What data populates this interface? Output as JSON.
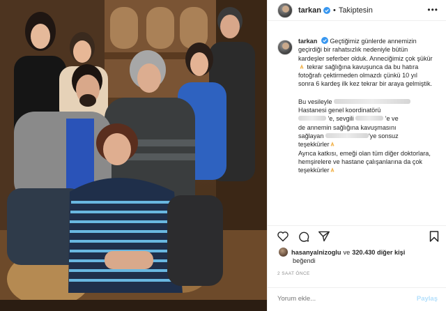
{
  "header": {
    "username": "tarkan",
    "follow_state": "Takiptesin",
    "separator": "•",
    "more_glyph": "•••"
  },
  "caption": {
    "username": "tarkan",
    "line1": "Geçtiğimiz günlerde annemizin geçirdiği bir rahatsızlık nedeniyle bütün kardeşler seferber olduk. Anneciğimiz çok şükür",
    "line1b": " tekrar sağlığına kavuşunca da bu hatıra fotoğrafı çektirmeden olmazdı çünkü 10 yıl sonra 6 kardeş ilk kez tekrar bir araya gelmiştik.",
    "p2_start": "Bu vesileyle",
    "p2_hospital": "Hastanesi genel koordinatörü",
    "p2_e1": "'e, sevgili",
    "p2_e2": "'e ve",
    "p2_line": "de annemin sağlığına kavuşmasını",
    "p2_saglayan": "sağlayan",
    "p2_sonsuz": "'ye sonsuz",
    "p2_tesekkur": "teşekkürler",
    "p3": "Ayrıca katkısı, emeği olan tüm diğer doktorlara, hemşirelere ve hastane çalışanlarına da çok teşekkürler"
  },
  "likes": {
    "user": "hasanyalnizoglu",
    "connector": "ve",
    "count_text": "320.430 diğer kişi",
    "suffix": "beğendi"
  },
  "timestamp": "2 SAAT ÖNCE",
  "comment": {
    "placeholder": "Yorum ekle...",
    "post_label": "Paylaş"
  },
  "icons": {
    "verified": "verified-badge-icon",
    "like": "heart-icon",
    "comment": "comment-bubble-icon",
    "share": "paper-plane-icon",
    "save": "bookmark-icon",
    "pray": "folded-hands-emoji"
  },
  "colors": {
    "text": "#262626",
    "muted": "#8e8e8e",
    "verified": "#3897f0",
    "post_disabled": "#b2dffc",
    "border": "#efefef"
  }
}
